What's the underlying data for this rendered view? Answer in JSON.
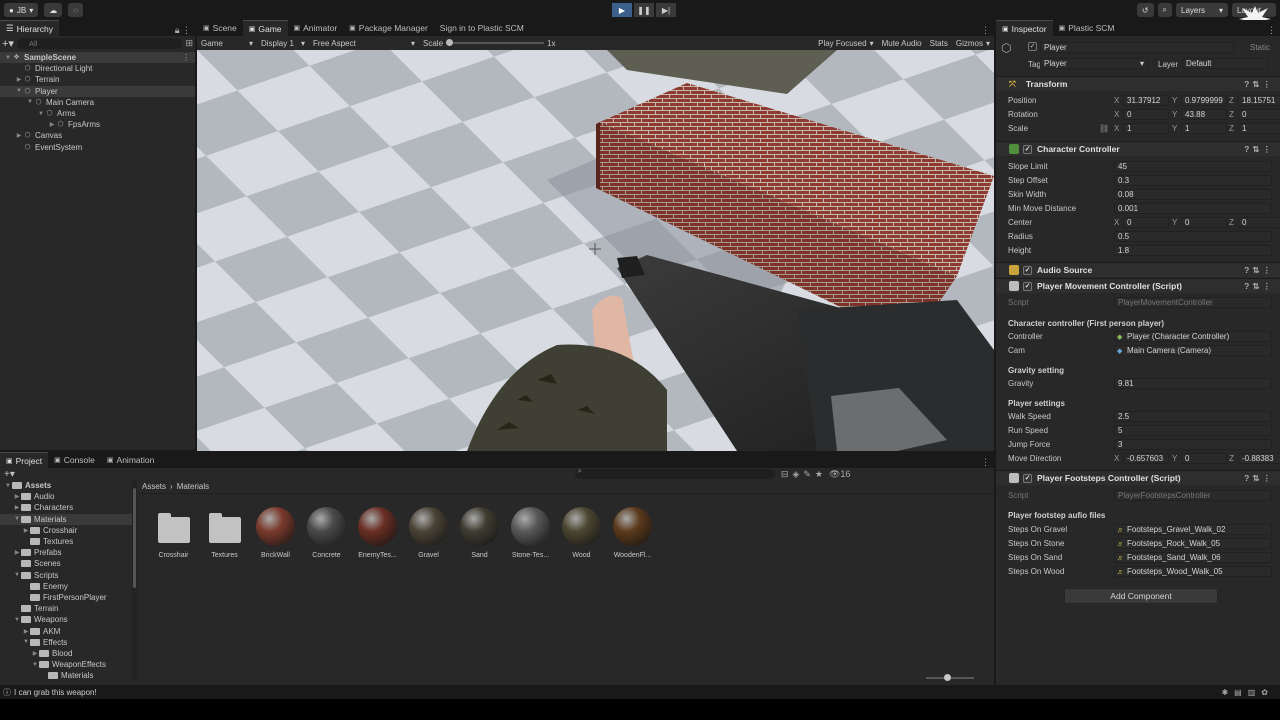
{
  "toolbar": {
    "account": "JB",
    "layers": "Layers",
    "layout": "Layout"
  },
  "hierarchy": {
    "tab": "Hierarchy",
    "search_placeholder": "All",
    "items": [
      {
        "label": "SampleScene",
        "depth": 0,
        "arrow": "open",
        "icon": "unity-scene-icon",
        "selected": true,
        "bold": true
      },
      {
        "label": "Directional Light",
        "depth": 1,
        "arrow": "none",
        "icon": "gameobject-icon"
      },
      {
        "label": "Terrain",
        "depth": 1,
        "arrow": "closed",
        "icon": "gameobject-icon"
      },
      {
        "label": "Player",
        "depth": 1,
        "arrow": "open",
        "icon": "gameobject-icon",
        "selected": true
      },
      {
        "label": "Main Camera",
        "depth": 2,
        "arrow": "open",
        "icon": "gameobject-icon"
      },
      {
        "label": "Arms",
        "depth": 3,
        "arrow": "open",
        "icon": "gameobject-icon"
      },
      {
        "label": "FpsArms",
        "depth": 4,
        "arrow": "closed",
        "icon": "gameobject-icon"
      },
      {
        "label": "Canvas",
        "depth": 1,
        "arrow": "closed",
        "icon": "gameobject-icon"
      },
      {
        "label": "EventSystem",
        "depth": 1,
        "arrow": "none",
        "icon": "gameobject-icon"
      }
    ]
  },
  "game": {
    "tabs": [
      {
        "label": "Scene",
        "icon": "scene-icon"
      },
      {
        "label": "Game",
        "icon": "game-icon",
        "active": true
      },
      {
        "label": "Animator",
        "icon": "animator-icon"
      },
      {
        "label": "Package Manager",
        "icon": "package-icon"
      },
      {
        "label": "Sign in to Plastic SCM",
        "icon": ""
      }
    ],
    "view_mode": "Game",
    "display": "Display 1",
    "aspect": "Free Aspect",
    "scale_label": "Scale",
    "scale_value": "1x",
    "play_focused": "Play Focused",
    "mute_audio": "Mute Audio",
    "stats": "Stats",
    "gizmos": "Gizmos"
  },
  "project": {
    "tabs": [
      {
        "label": "Project",
        "icon": "folder-icon",
        "active": true
      },
      {
        "label": "Console",
        "icon": "console-icon"
      },
      {
        "label": "Animation",
        "icon": "animation-icon"
      }
    ],
    "tree": [
      {
        "label": "Assets",
        "depth": 0,
        "arrow": "open",
        "bold": true
      },
      {
        "label": "Audio",
        "depth": 1,
        "arrow": "closed"
      },
      {
        "label": "Characters",
        "depth": 1,
        "arrow": "closed"
      },
      {
        "label": "Materials",
        "depth": 1,
        "arrow": "open",
        "selected": true
      },
      {
        "label": "Crosshair",
        "depth": 2,
        "arrow": "closed"
      },
      {
        "label": "Textures",
        "depth": 2,
        "arrow": "none"
      },
      {
        "label": "Prefabs",
        "depth": 1,
        "arrow": "closed"
      },
      {
        "label": "Scenes",
        "depth": 1,
        "arrow": "none"
      },
      {
        "label": "Scripts",
        "depth": 1,
        "arrow": "open"
      },
      {
        "label": "Enemy",
        "depth": 2,
        "arrow": "none"
      },
      {
        "label": "FirstPersonPlayer",
        "depth": 2,
        "arrow": "none"
      },
      {
        "label": "Terrain",
        "depth": 1,
        "arrow": "none"
      },
      {
        "label": "Weapons",
        "depth": 1,
        "arrow": "open"
      },
      {
        "label": "AKM",
        "depth": 2,
        "arrow": "closed"
      },
      {
        "label": "Effects",
        "depth": 2,
        "arrow": "open"
      },
      {
        "label": "Blood",
        "depth": 3,
        "arrow": "closed"
      },
      {
        "label": "WeaponEffects",
        "depth": 3,
        "arrow": "open"
      },
      {
        "label": "Materials",
        "depth": 4,
        "arrow": "none"
      }
    ],
    "breadcrumb": [
      "Assets",
      "Materials"
    ],
    "count": "16",
    "assets": [
      {
        "name": "Crosshair",
        "kind": "folder"
      },
      {
        "name": "Textures",
        "kind": "folder"
      },
      {
        "name": "BrickWall",
        "kind": "material",
        "color": "#7a3a2c"
      },
      {
        "name": "Concrete",
        "kind": "material",
        "color": "#4a4a4a"
      },
      {
        "name": "EnemyTes...",
        "kind": "material",
        "color": "#6a2e24"
      },
      {
        "name": "Gravel",
        "kind": "material",
        "color": "#4a4336"
      },
      {
        "name": "Sand",
        "kind": "material",
        "color": "#3f3c30"
      },
      {
        "name": "Stone-Tes...",
        "kind": "material",
        "color": "#585858"
      },
      {
        "name": "Wood",
        "kind": "material",
        "color": "#4b4530"
      },
      {
        "name": "WoodenFl...",
        "kind": "material",
        "color": "#5c3a1c"
      }
    ]
  },
  "status": {
    "message": "I can grab this weapon!"
  },
  "inspector": {
    "tabs": [
      {
        "label": "Inspector",
        "icon": "inspector-icon",
        "active": true
      },
      {
        "label": "Plastic SCM",
        "icon": "plastic-icon"
      }
    ],
    "object_name": "Player",
    "static_label": "Static",
    "tag_label": "Tag",
    "tag": "Player",
    "layer_label": "Layer",
    "layer": "Default",
    "transform": {
      "title": "Transform",
      "position_label": "Position",
      "position": {
        "x": "31.37912",
        "y": "0.9799999",
        "z": "18.15751"
      },
      "rotation_label": "Rotation",
      "rotation": {
        "x": "0",
        "y": "43.88",
        "z": "0"
      },
      "scale_label": "Scale",
      "scale": {
        "x": "1",
        "y": "1",
        "z": "1"
      }
    },
    "character_controller": {
      "title": "Character Controller",
      "slope_limit_label": "Slope Limit",
      "slope_limit": "45",
      "step_offset_label": "Step Offset",
      "step_offset": "0.3",
      "skin_width_label": "Skin Width",
      "skin_width": "0.08",
      "min_move_label": "Min Move Distance",
      "min_move": "0.001",
      "center_label": "Center",
      "center": {
        "x": "0",
        "y": "0",
        "z": "0"
      },
      "radius_label": "Radius",
      "radius": "0.5",
      "height_label": "Height",
      "height": "1.8"
    },
    "audio_source": {
      "title": "Audio Source"
    },
    "movement": {
      "title": "Player Movement Controller (Script)",
      "script_label": "Script",
      "script": "PlayerMovementController",
      "section1": "Character controller (First person player)",
      "controller_label": "Controller",
      "controller": "Player (Character Controller)",
      "cam_label": "Cam",
      "cam": "Main Camera (Camera)",
      "section2": "Gravity setting",
      "gravity_label": "Gravity",
      "gravity": "9.81",
      "section3": "Player settings",
      "walk_label": "Walk Speed",
      "walk": "2.5",
      "run_label": "Run Speed",
      "run": "5",
      "jump_label": "Jump Force",
      "jump": "3",
      "move_dir_label": "Move Direction",
      "move_dir": {
        "x": "-0.657603",
        "y": "0",
        "z": "-0.88383"
      }
    },
    "footsteps": {
      "title": "Player Footsteps Controller (Script)",
      "script_label": "Script",
      "script": "PlayerFootstepsController",
      "section": "Player footstep aufio files",
      "gravel_label": "Steps On Gravel",
      "gravel": "Footsteps_Gravel_Walk_02",
      "stone_label": "Steps On Stone",
      "stone": "Footsteps_Rock_Walk_05",
      "sand_label": "Steps On Sand",
      "sand": "Footsteps_Sand_Walk_06",
      "wood_label": "Steps On Wood",
      "wood": "Footsteps_Wood_Walk_05"
    },
    "add_component": "Add Component"
  },
  "colors": {
    "accent": "#3c5f8c",
    "panel_bg": "#282828",
    "editor_bg": "#191919",
    "brick": "#8f3a2e",
    "floor_light": "#d9dde2",
    "floor_dark": "#b4b8bf"
  }
}
